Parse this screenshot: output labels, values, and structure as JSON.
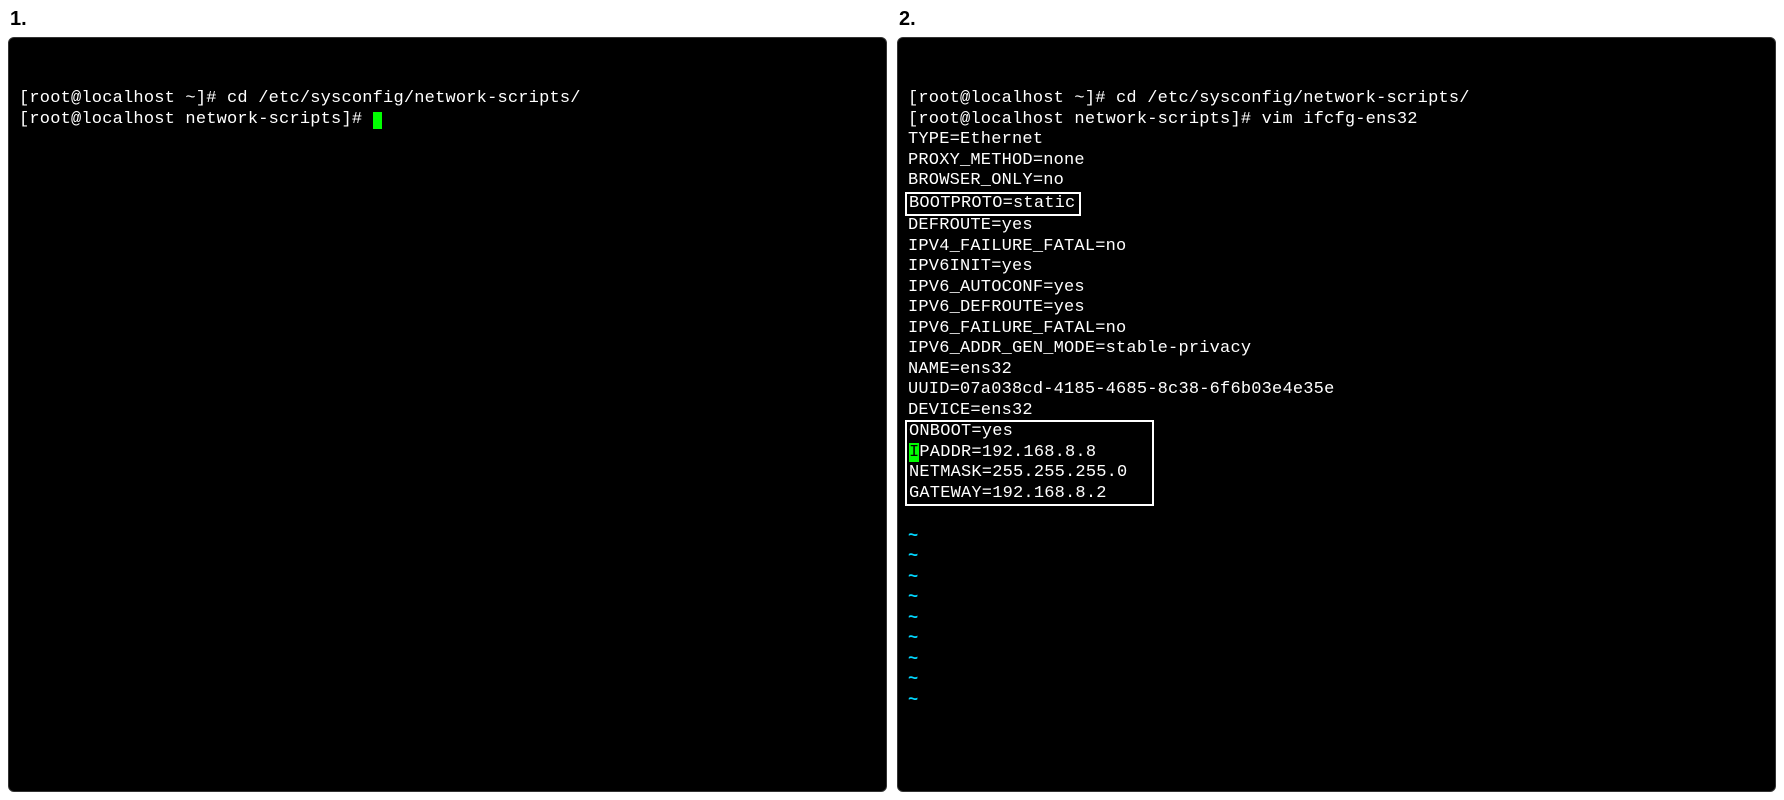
{
  "panel1": {
    "label": "1.",
    "line1": "[root@localhost ~]# cd /etc/sysconfig/network-scripts/",
    "line2": "[root@localhost network-scripts]# "
  },
  "panel2": {
    "label": "2.",
    "line1": "[root@localhost ~]# cd /etc/sysconfig/network-scripts/",
    "line2": "[root@localhost network-scripts]# vim ifcfg-ens32",
    "blank": "",
    "cfg": {
      "type": "TYPE=Ethernet",
      "proxy": "PROXY_METHOD=none",
      "browser": "BROWSER_ONLY=no",
      "bootproto": "BOOTPROTO=static",
      "defroute": "DEFROUTE=yes",
      "ipv4fail": "IPV4_FAILURE_FATAL=no",
      "ipv6init": "IPV6INIT=yes",
      "ipv6auto": "IPV6_AUTOCONF=yes",
      "ipv6defroute": "IPV6_DEFROUTE=yes",
      "ipv6fail": "IPV6_FAILURE_FATAL=no",
      "ipv6addr": "IPV6_ADDR_GEN_MODE=stable-privacy",
      "name": "NAME=ens32",
      "uuid": "UUID=07a038cd-4185-4685-8c38-6f6b03e4e35e",
      "device": "DEVICE=ens32",
      "onboot": "ONBOOT=yes            ",
      "ipaddr_cursor": "I",
      "ipaddr_rest": "PADDR=192.168.8.8     ",
      "netmask": "NETMASK=255.255.255.0 ",
      "gateway": "GATEWAY=192.168.8.2   "
    },
    "tilde": "~"
  }
}
